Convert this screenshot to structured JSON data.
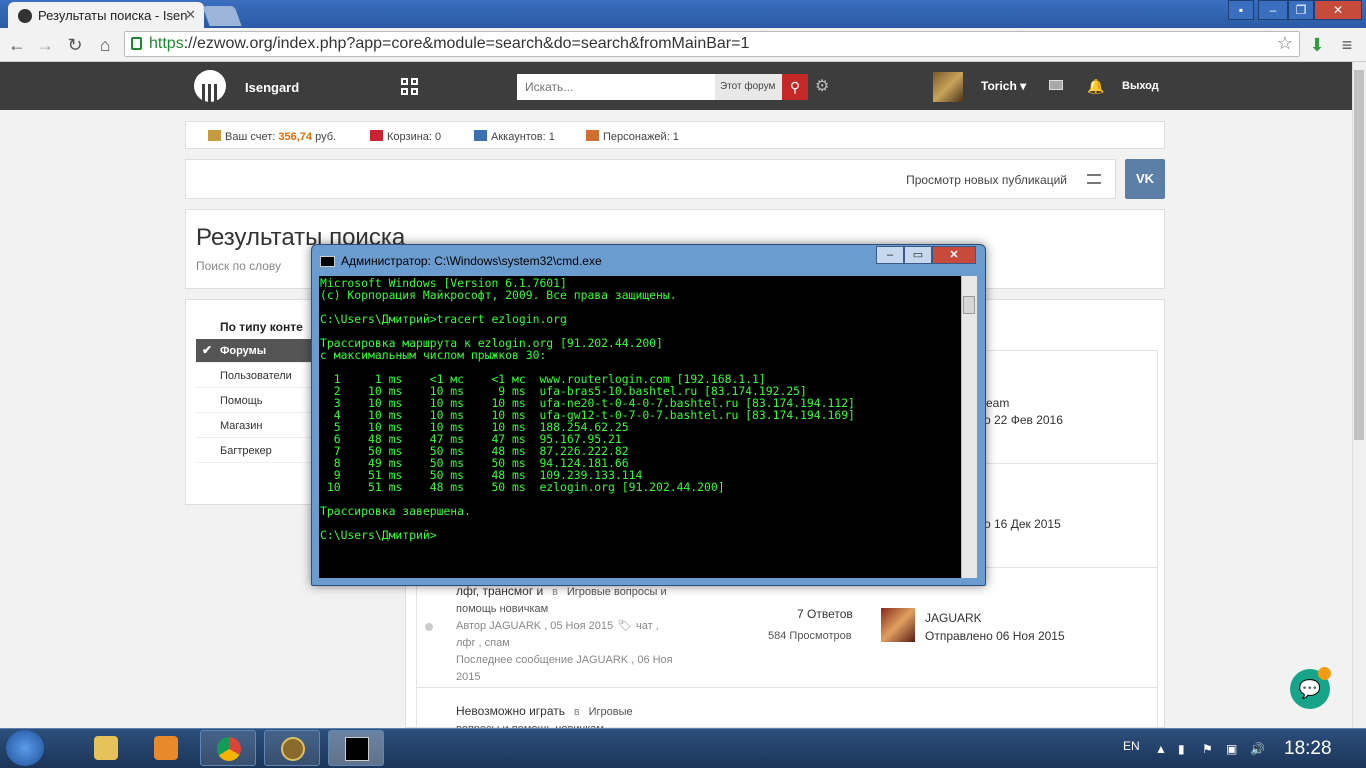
{
  "browser": {
    "tab_title": "Результаты поиска - Isen",
    "url_https": "https",
    "url_rest": "://ezwow.org/index.php?app=core&module=search&do=search&fromMainBar=1"
  },
  "header": {
    "brand": "Isengard",
    "search_placeholder": "Искать...",
    "search_scope": "Этот форум",
    "username": "Torich",
    "logout": "Выход"
  },
  "infobar": {
    "balance_label": "Ваш счет:",
    "balance_value": "356,74",
    "balance_unit": "руб.",
    "cart": "Корзина: 0",
    "accounts": "Аккаунтов: 1",
    "characters": "Персонажей: 1"
  },
  "newpub": {
    "label": "Просмотр новых публикаций",
    "vk": "VK"
  },
  "results": {
    "title": "Результаты поиска",
    "subtitle": "Поиск по слову"
  },
  "sidebar": {
    "heading": "По типу конте",
    "items": [
      {
        "label": "Форумы"
      },
      {
        "label": "Пользователи"
      },
      {
        "label": "Помощь"
      },
      {
        "label": "Магазин"
      },
      {
        "label": "Багтрекер"
      }
    ]
  },
  "topics": [
    {
      "partial_author": "eam",
      "partial_date": "о 22 Фев 2016"
    },
    {
      "partial_date": "о 16 Дек 2015"
    },
    {
      "title_a": "лфг, трансмог и",
      "in": "в",
      "forum_a": "Игровые вопросы и",
      "forum_b": "помощь новичкам",
      "meta1": "Автор  JAGUARK , 05 Ноя 2015",
      "tags1": "чат ,",
      "tags2": "лфг ,  спам",
      "last1": "Последнее сообщение  JAGUARK ,  06 Ноя",
      "last2": "2015",
      "replies": "7 Ответов",
      "views": "584 Просмотров",
      "last_author": "JAGUARK",
      "last_date": "Отправлено 06 Ноя 2015"
    },
    {
      "title": "Невозможно играть",
      "in": "в",
      "forum_a": "Игровые",
      "forum_b": "вопросы и помощь новичкам"
    }
  ],
  "cmd": {
    "title": "Администратор: C:\\Windows\\system32\\cmd.exe",
    "output": "Microsoft Windows [Version 6.1.7601]\n(c) Корпорация Майкрософт, 2009. Все права защищены.\n\nC:\\Users\\Дмитрий>tracert ezlogin.org\n\nТрассировка маршрута к ezlogin.org [91.202.44.200]\nс максимальным числом прыжков 30:\n\n  1     1 ms    <1 мс    <1 мс  www.routerlogin.com [192.168.1.1]\n  2    10 ms    10 ms     9 ms  ufa-bras5-10.bashtel.ru [83.174.192.25]\n  3    10 ms    10 ms    10 ms  ufa-ne20-t-0-4-0-7.bashtel.ru [83.174.194.112]\n  4    10 ms    10 ms    10 ms  ufa-gw12-t-0-7-0-7.bashtel.ru [83.174.194.169]\n  5    10 ms    10 ms    10 ms  188.254.62.25\n  6    48 ms    47 ms    47 ms  95.167.95.21\n  7    50 ms    50 ms    48 ms  87.226.222.82\n  8    49 ms    50 ms    50 ms  94.124.181.66\n  9    51 ms    50 ms    48 ms  109.239.133.114\n 10    51 ms    48 ms    50 ms  ezlogin.org [91.202.44.200]\n\nТрассировка завершена.\n\nC:\\Users\\Дмитрий>"
  },
  "taskbar": {
    "lang": "EN",
    "clock": "18:28"
  },
  "colors": {
    "accent": "#c62828",
    "header": "#3d3d3d",
    "cmd_text": "#33ff33",
    "balance": "#e06c00"
  }
}
